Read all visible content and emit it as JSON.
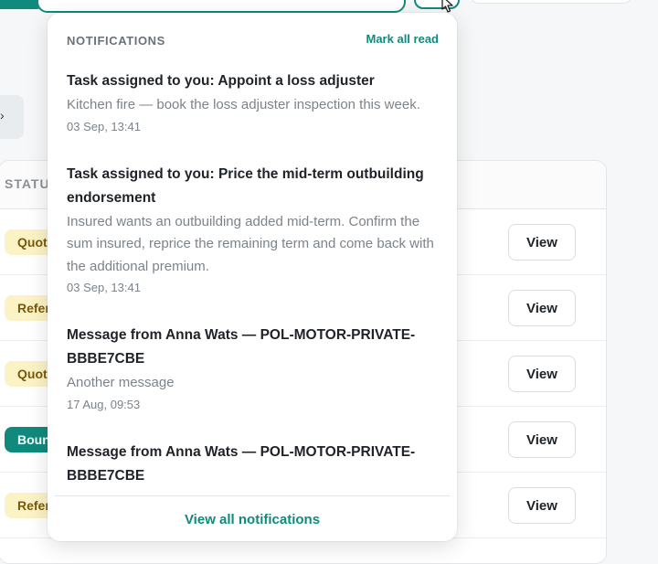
{
  "notifications": {
    "title": "NOTIFICATIONS",
    "mark_all_read": "Mark all read",
    "view_all": "View all notifications",
    "items": [
      {
        "title": "Task assigned to you: Appoint a loss adjuster",
        "body": "Kitchen fire — book the loss adjuster inspection this week.",
        "time": "03 Sep, 13:41"
      },
      {
        "title": "Task assigned to you: Price the mid-term outbuilding endorsement",
        "body": "Insured wants an outbuilding added mid-term. Confirm the sum insured, reprice the remaining term and come back with the additional premium.",
        "time": "03 Sep, 13:41"
      },
      {
        "title": "Message from Anna Wats — POL-MOTOR-PRIVATE-BBBE7CBE",
        "body": "Another message",
        "time": "17 Aug, 09:53"
      },
      {
        "title": "Message from Anna Wats — POL-MOTOR-PRIVATE-BBBE7CBE",
        "body": "",
        "time": ""
      }
    ]
  },
  "table": {
    "status_header": "STATUS",
    "rows": [
      {
        "status": "Quoted",
        "status_color": "yellow",
        "action": "View"
      },
      {
        "status": "Referred",
        "status_color": "yellow",
        "action": "View"
      },
      {
        "status": "Quoted",
        "status_color": "yellow",
        "action": "View"
      },
      {
        "status": "Bound",
        "status_color": "teal",
        "action": "View"
      },
      {
        "status": "Referred",
        "status_color": "yellow",
        "action": "View"
      }
    ]
  },
  "filter": {
    "icon": "chevron-right-icon"
  },
  "cursor": {
    "icon": "pointer-cursor-icon"
  },
  "colors": {
    "accent": "#0f8a7c",
    "badge_yellow_bg": "#fbf3c6",
    "badge_yellow_text": "#7a5a05",
    "muted_text": "#7d8388"
  }
}
